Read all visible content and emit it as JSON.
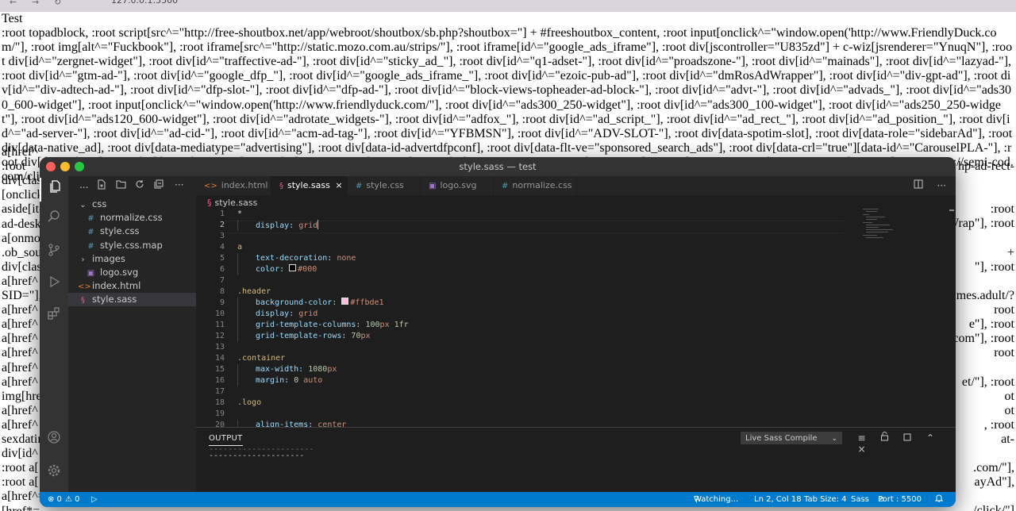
{
  "browser": {
    "back": "←",
    "forward": "→",
    "reload": "↻",
    "url": "127.0.0.1:5500"
  },
  "page": {
    "heading": "Test",
    "lines": [
      ":root topadblock, :root script[src^=\"http://free-shoutbox.net/app/webroot/shoutbox/sb.php?shoutbox=\"] + #freeshoutbox_content, :root input[onclick^=\"window.open('http://www.FriendlyDuck.com/\"], :root img[alt^=\"Fuckbook\"], :root iframe[src^=\"http://static.mozo.com.au/strips/\"], :root iframe[id^=\"google_ads_iframe\"], :root div[jscontroller=\"U835zd\"] + c-wiz[jsrenderer=\"YnuqN\"], :root div[id^=\"zergnet-widget\"], :root div[id^=\"traffective-ad-\"], :root div[id^=\"sticky_ad_\"], :root div[id^=\"q1-adset-\"], :root div[id^=\"proadszone-\"], :root div[id^=\"mainads\"], :root div[id^=\"lazyad-\"], :root div[id^=\"gtm-ad-\"], :root div[id^=\"google_dfp_\"], :root div[id^=\"google_ads_iframe_\"], :root div[id^=\"ezoic-pub-ad\"], :root div[id^=\"dmRosAdWrapper\"], :root div[id^=\"div-gpt-ad\"], :root div[id^=\"div-adtech-ad-\"], :root div[id^=\"dfp-slot-\"], :root div[id^=\"dfp-ad-\"], :root div[id^=\"block-views-topheader-ad-block-\"], :root div[id^=\"advt-\"], :root div[id^=\"advads_\"], :root div[id^=\"ads300_600-widget\"], :root input[onclick^=\"window.open('http://www.friendlyduck.com/\"], :root div[id^=\"ads300_250-widget\"], :root div[id^=\"ads300_100-widget\"], :root div[id^=\"ads250_250-widget\"], :root div[id^=\"ads120_600-widget\"], :root div[id^=\"adrotate_widgets-\"], :root div[id^=\"adfox_\"], :root div[id^=\"ad_script_\"], :root div[id^=\"ad_rect_\"], :root div[id^=\"ad_position_\"], :root div[id^=\"ad-server-\"], :root div[id^=\"ad-cid-\"], :root div[id^=\"acm-ad-tag-\"], :root div[id^=\"YFBMSN\"], :root div[id^=\"ADV-SLOT-\"], :root div[data-spotim-slot], :root div[data-role=\"sidebarAd\"], :root div[data-native_ad], :root div[data-mediatype=\"advertising\"], :root div[data-id-advertdfpconf], :root div[data-flt-ve=\"sponsored_search_ads\"], :root div[data-crl=\"true\"][data-id^=\"CarouselPLA-\"], :root div[data-adunit], :root div[data-adunit-path], :root div[class^=\"proadszone-\"], :root div[class^=\"pane-google-admanager-\"], :root a[href^=\"http://adultgames.xxx/\"], :root a[href^=\"http://semi-cod.com/clicks/\"], :root div[class^=\"index_displayAd_\"], :root"
    ],
    "peek_left": [
      "a[href^",
      ":root",
      "div[clas",
      "[onclick",
      "aside[ite",
      "ad-desk",
      "a[onmo",
      ".ob_sou",
      "div[clas",
      "a[href^",
      "SID=\"],",
      "a[href^",
      "a[href^",
      "a[href^",
      "a[href^",
      "a[href^",
      "a[href^",
      "img[hre",
      "a[href^",
      "a[href^",
      "sexdatin",
      "div[id^",
      ":root a[",
      ":root a[",
      "a[href^=",
      "[href*="
    ],
    "peek_right": [
      "hp-ad-rect-",
      "",
      "",
      ":root",
      "Wrap\"], :root",
      "",
      "+",
      "\"], :root",
      "",
      "mes.adult/?",
      "root",
      "e\"], :root",
      ".com\"], :root",
      "root",
      "",
      "et/\"], :root",
      "ot",
      "ot",
      ", :root",
      "at-",
      "",
      ".com/\"],",
      "ayAd\"],",
      "",
      "/click/\"]",
      ""
    ]
  },
  "vscode": {
    "title": "style.sass — test",
    "tabs": [
      {
        "icon": "<>",
        "label": "index.html",
        "active": false
      },
      {
        "icon": "§",
        "label": "style.sass",
        "active": true,
        "close": "×"
      },
      {
        "icon": "#",
        "label": "style.css",
        "active": false
      },
      {
        "icon": "▣",
        "label": "logo.svg",
        "active": false
      },
      {
        "icon": "#",
        "label": "normalize.css",
        "active": false
      }
    ],
    "breadcrumb": "style.sass",
    "explorer": {
      "header_more": "...",
      "items": [
        {
          "label": "css",
          "type": "folder",
          "icon": "⌄"
        },
        {
          "label": "normalize.css",
          "type": "file",
          "icon": "#"
        },
        {
          "label": "style.css",
          "type": "file",
          "icon": "#"
        },
        {
          "label": "style.css.map",
          "type": "file",
          "icon": "#"
        },
        {
          "label": "images",
          "type": "folder",
          "icon": "›"
        },
        {
          "label": "logo.svg",
          "type": "file",
          "icon": "▣"
        },
        {
          "label": "index.html",
          "type": "file",
          "icon": "<>"
        },
        {
          "label": "style.sass",
          "type": "file",
          "icon": "§",
          "selected": true
        }
      ]
    },
    "line_numbers": [
      "1",
      "2",
      "3",
      "4",
      "5",
      "6",
      "7",
      "8",
      "9",
      "10",
      "11",
      "12",
      "13",
      "14",
      "15",
      "16",
      "17",
      "18",
      "19",
      "20"
    ],
    "code": {
      "l1": "*",
      "l2p": "display:",
      "l2v": "grid",
      "l4": "a",
      "l5p": "text-decoration:",
      "l5v": "none",
      "l6p": "color:",
      "l6v": "#000",
      "l8": ".header",
      "l9p": "background-color:",
      "l9v": "#ffbde1",
      "l10p": "display:",
      "l10v": "grid",
      "l11p": "grid-template-columns:",
      "l11n": "100",
      "l11u": "px",
      "l11n2": "1fr",
      "l12p": "grid-template-rows:",
      "l12n": "70",
      "l12u": "px",
      "l14": ".container",
      "l15p": "max-width:",
      "l15n": "1080",
      "l15u": "px",
      "l16p": "margin:",
      "l16n": "0",
      "l16v": "auto",
      "l18": ".logo",
      "l20p": "align-items:",
      "l20v": "center"
    },
    "colors": {
      "swatch_black": "#000000",
      "swatch_pink": "#ffbde1",
      "status": "#007acc"
    },
    "panel": {
      "title": "OUTPUT",
      "dropdown": "Live Sass Compile",
      "line1": "----------------------",
      "line2": "--------------------"
    },
    "status": {
      "remote": "><",
      "errors": "⊗ 0",
      "warnings": "⚠ 0",
      "run": "▷",
      "watching": "Watching...",
      "position": "Ln 2, Col 18",
      "tabsize": "Tab Size: 4",
      "language": "Sass",
      "port": "Port : 5500",
      "bell": "🔔"
    },
    "activity_badge": "1"
  }
}
